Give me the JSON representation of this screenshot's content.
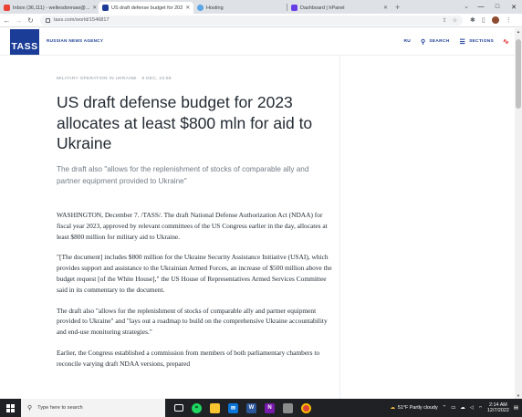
{
  "browser": {
    "tabs": [
      {
        "title": "Inbox (36,111) - wellesdonnaw@...",
        "favicon_color": "#ea4335",
        "active": false
      },
      {
        "title": "US draft defense budget for 202",
        "favicon_color": "#1b3d97",
        "active": true
      },
      {
        "title": "Hosting",
        "favicon_color": "#5ba4e5",
        "active": false
      },
      {
        "title": "Dashboard | hPanel",
        "favicon_color": "#673de6",
        "active": false
      }
    ],
    "url": "tass.com/world/1546817",
    "window_controls": {
      "minimize": "—",
      "maximize": "□",
      "close": "✕"
    }
  },
  "site": {
    "logo": "TASS",
    "tagline": "RUSSIAN NEWS AGENCY",
    "nav": {
      "lang": "RU",
      "search": "SEARCH",
      "sections": "SECTIONS"
    },
    "brand_color": "#1b3d97"
  },
  "article": {
    "category": "MILITARY OPERATION IN UKRAINE",
    "date": "8 DEC, 23:58",
    "headline": "US draft defense budget for 2023 allocates at least $800 mln for aid to Ukraine",
    "lead": "The draft also \"allows for the replenishment of stocks of comparable ally and partner equipment provided to Ukraine\"",
    "paragraphs": [
      "WASHINGTON, December 7. /TASS/. The draft National Defense Authorization Act (NDAA) for fiscal year 2023, approved by relevant committees of the US Congress earlier in the day, allocates at least $800 million for military aid to Ukraine.",
      "\"[The document] includes $800 million for the Ukraine Security Assistance Initiative (USAI), which provides support and assistance to the Ukrainian Armed Forces, an increase of $500 million above the budget request [of the White House],\" the US House of Representatives Armed Services Committee said in its commentary to the document.",
      "The draft also \"allows for the replenishment of stocks of comparable ally and partner equipment provided to Ukraine\" and \"lays out a roadmap to build on the comprehensive Ukraine accountability and end-use monitoring strategies.\"",
      "Earlier, the Congress established a commission from members of both parliamentary chambers to reconcile varying draft NDAA versions, prepared"
    ]
  },
  "taskbar": {
    "search_placeholder": "Type here to search",
    "weather": "51°F  Partly cloudy",
    "time": "2:14 AM",
    "date": "12/7/2022"
  }
}
